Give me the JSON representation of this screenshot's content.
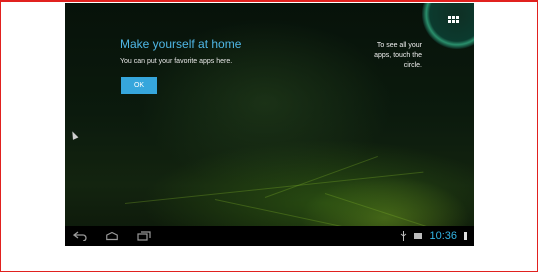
{
  "tooltip": {
    "title": "Make yourself at home",
    "body": "You can put your favorite apps here.",
    "ok_label": "OK"
  },
  "launcher_hint": {
    "line1": "To see all your",
    "line2": "apps, touch the",
    "line3": "circle."
  },
  "status_bar": {
    "time": "10:36"
  },
  "colors": {
    "accent": "#33b5e5",
    "frame_border": "#e1211f",
    "button_bg": "#36a6dc"
  },
  "icons": {
    "launcher": "all-apps-grid-icon",
    "back": "back-icon",
    "home": "home-icon",
    "recents": "recent-apps-icon",
    "usb": "usb-icon",
    "sd": "sd-card-icon",
    "battery": "battery-icon"
  }
}
